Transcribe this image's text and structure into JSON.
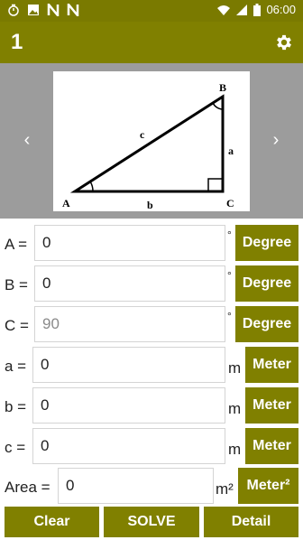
{
  "status_bar": {
    "time": "06:00",
    "icons": [
      "timer-icon",
      "image-icon",
      "n-icon",
      "n-icon",
      "wifi-icon",
      "signal-icon",
      "battery-icon"
    ]
  },
  "app_bar": {
    "title": "1",
    "settings_icon": "gear-icon"
  },
  "diagram": {
    "vertex_a": "A",
    "vertex_b": "B",
    "vertex_c": "C",
    "side_a": "a",
    "side_b": "b",
    "side_c": "c"
  },
  "inputs": {
    "A": {
      "label": "A =",
      "value": "0",
      "sup": "°",
      "unit_button": "Degree"
    },
    "B": {
      "label": "B =",
      "value": "0",
      "sup": "°",
      "unit_button": "Degree"
    },
    "C": {
      "label": "C =",
      "value": "90",
      "sup": "°",
      "unit_button": "Degree"
    },
    "a": {
      "label": "a =",
      "value": "0",
      "unit": "m",
      "unit_button": "Meter"
    },
    "b": {
      "label": "b =",
      "value": "0",
      "unit": "m",
      "unit_button": "Meter"
    },
    "c": {
      "label": "c =",
      "value": "0",
      "unit": "m",
      "unit_button": "Meter"
    },
    "area": {
      "label": "Area =",
      "value": "0",
      "unit": "m²",
      "unit_button": "Meter²"
    }
  },
  "buttons": {
    "clear": "Clear",
    "solve": "SOLVE",
    "detail": "Detail"
  },
  "colors": {
    "primary": "#808000",
    "status_bar": "#7a7a00",
    "carousel_bg": "#9c9c9c"
  }
}
